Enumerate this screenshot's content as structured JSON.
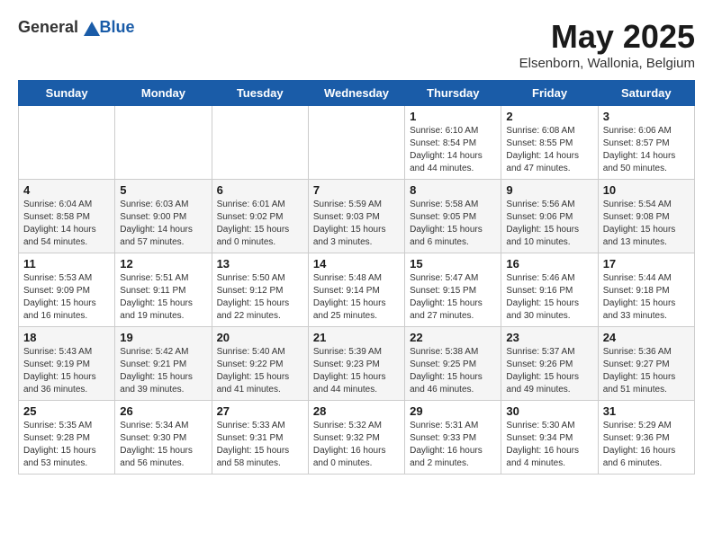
{
  "logo": {
    "text_general": "General",
    "text_blue": "Blue"
  },
  "title": "May 2025",
  "subtitle": "Elsenborn, Wallonia, Belgium",
  "days_of_week": [
    "Sunday",
    "Monday",
    "Tuesday",
    "Wednesday",
    "Thursday",
    "Friday",
    "Saturday"
  ],
  "weeks": [
    [
      {
        "day": "",
        "info": ""
      },
      {
        "day": "",
        "info": ""
      },
      {
        "day": "",
        "info": ""
      },
      {
        "day": "",
        "info": ""
      },
      {
        "day": "1",
        "info": "Sunrise: 6:10 AM\nSunset: 8:54 PM\nDaylight: 14 hours\nand 44 minutes."
      },
      {
        "day": "2",
        "info": "Sunrise: 6:08 AM\nSunset: 8:55 PM\nDaylight: 14 hours\nand 47 minutes."
      },
      {
        "day": "3",
        "info": "Sunrise: 6:06 AM\nSunset: 8:57 PM\nDaylight: 14 hours\nand 50 minutes."
      }
    ],
    [
      {
        "day": "4",
        "info": "Sunrise: 6:04 AM\nSunset: 8:58 PM\nDaylight: 14 hours\nand 54 minutes."
      },
      {
        "day": "5",
        "info": "Sunrise: 6:03 AM\nSunset: 9:00 PM\nDaylight: 14 hours\nand 57 minutes."
      },
      {
        "day": "6",
        "info": "Sunrise: 6:01 AM\nSunset: 9:02 PM\nDaylight: 15 hours\nand 0 minutes."
      },
      {
        "day": "7",
        "info": "Sunrise: 5:59 AM\nSunset: 9:03 PM\nDaylight: 15 hours\nand 3 minutes."
      },
      {
        "day": "8",
        "info": "Sunrise: 5:58 AM\nSunset: 9:05 PM\nDaylight: 15 hours\nand 6 minutes."
      },
      {
        "day": "9",
        "info": "Sunrise: 5:56 AM\nSunset: 9:06 PM\nDaylight: 15 hours\nand 10 minutes."
      },
      {
        "day": "10",
        "info": "Sunrise: 5:54 AM\nSunset: 9:08 PM\nDaylight: 15 hours\nand 13 minutes."
      }
    ],
    [
      {
        "day": "11",
        "info": "Sunrise: 5:53 AM\nSunset: 9:09 PM\nDaylight: 15 hours\nand 16 minutes."
      },
      {
        "day": "12",
        "info": "Sunrise: 5:51 AM\nSunset: 9:11 PM\nDaylight: 15 hours\nand 19 minutes."
      },
      {
        "day": "13",
        "info": "Sunrise: 5:50 AM\nSunset: 9:12 PM\nDaylight: 15 hours\nand 22 minutes."
      },
      {
        "day": "14",
        "info": "Sunrise: 5:48 AM\nSunset: 9:14 PM\nDaylight: 15 hours\nand 25 minutes."
      },
      {
        "day": "15",
        "info": "Sunrise: 5:47 AM\nSunset: 9:15 PM\nDaylight: 15 hours\nand 27 minutes."
      },
      {
        "day": "16",
        "info": "Sunrise: 5:46 AM\nSunset: 9:16 PM\nDaylight: 15 hours\nand 30 minutes."
      },
      {
        "day": "17",
        "info": "Sunrise: 5:44 AM\nSunset: 9:18 PM\nDaylight: 15 hours\nand 33 minutes."
      }
    ],
    [
      {
        "day": "18",
        "info": "Sunrise: 5:43 AM\nSunset: 9:19 PM\nDaylight: 15 hours\nand 36 minutes."
      },
      {
        "day": "19",
        "info": "Sunrise: 5:42 AM\nSunset: 9:21 PM\nDaylight: 15 hours\nand 39 minutes."
      },
      {
        "day": "20",
        "info": "Sunrise: 5:40 AM\nSunset: 9:22 PM\nDaylight: 15 hours\nand 41 minutes."
      },
      {
        "day": "21",
        "info": "Sunrise: 5:39 AM\nSunset: 9:23 PM\nDaylight: 15 hours\nand 44 minutes."
      },
      {
        "day": "22",
        "info": "Sunrise: 5:38 AM\nSunset: 9:25 PM\nDaylight: 15 hours\nand 46 minutes."
      },
      {
        "day": "23",
        "info": "Sunrise: 5:37 AM\nSunset: 9:26 PM\nDaylight: 15 hours\nand 49 minutes."
      },
      {
        "day": "24",
        "info": "Sunrise: 5:36 AM\nSunset: 9:27 PM\nDaylight: 15 hours\nand 51 minutes."
      }
    ],
    [
      {
        "day": "25",
        "info": "Sunrise: 5:35 AM\nSunset: 9:28 PM\nDaylight: 15 hours\nand 53 minutes."
      },
      {
        "day": "26",
        "info": "Sunrise: 5:34 AM\nSunset: 9:30 PM\nDaylight: 15 hours\nand 56 minutes."
      },
      {
        "day": "27",
        "info": "Sunrise: 5:33 AM\nSunset: 9:31 PM\nDaylight: 15 hours\nand 58 minutes."
      },
      {
        "day": "28",
        "info": "Sunrise: 5:32 AM\nSunset: 9:32 PM\nDaylight: 16 hours\nand 0 minutes."
      },
      {
        "day": "29",
        "info": "Sunrise: 5:31 AM\nSunset: 9:33 PM\nDaylight: 16 hours\nand 2 minutes."
      },
      {
        "day": "30",
        "info": "Sunrise: 5:30 AM\nSunset: 9:34 PM\nDaylight: 16 hours\nand 4 minutes."
      },
      {
        "day": "31",
        "info": "Sunrise: 5:29 AM\nSunset: 9:36 PM\nDaylight: 16 hours\nand 6 minutes."
      }
    ]
  ]
}
